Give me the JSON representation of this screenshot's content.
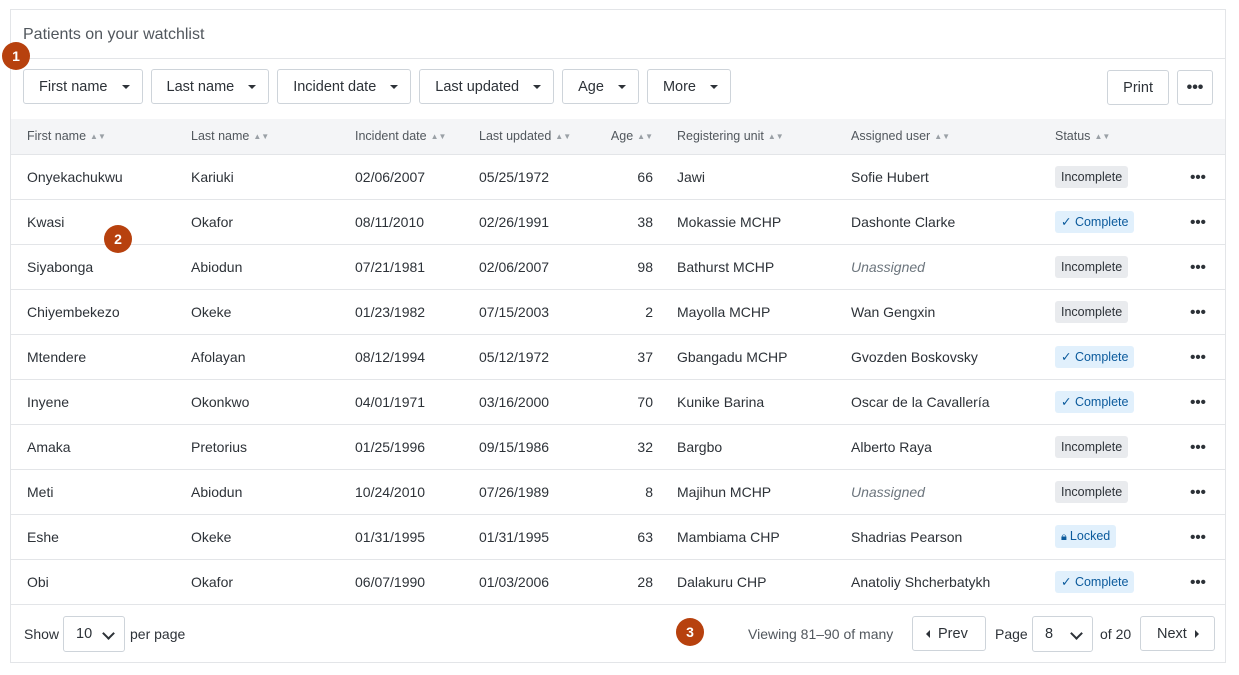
{
  "panel": {
    "title": "Patients on your watchlist"
  },
  "filters": [
    {
      "label": "First name"
    },
    {
      "label": "Last name"
    },
    {
      "label": "Incident date"
    },
    {
      "label": "Last updated"
    },
    {
      "label": "Age"
    },
    {
      "label": "More"
    }
  ],
  "toolbar": {
    "print_label": "Print",
    "more_icon": "ellipsis-icon"
  },
  "table": {
    "columns": [
      "First name",
      "Last name",
      "Incident date",
      "Last updated",
      "Age",
      "Registering unit",
      "Assigned user",
      "Status"
    ],
    "rows": [
      {
        "first": "Onyekachukwu",
        "last": "Kariuki",
        "incident": "02/06/2007",
        "updated": "05/25/1972",
        "age": "66",
        "unit": "Jawi",
        "user": "Sofie Hubert",
        "unassigned": false,
        "status": "Incomplete",
        "status_type": "incomplete"
      },
      {
        "first": "Kwasi",
        "last": "Okafor",
        "incident": "08/11/2010",
        "updated": "02/26/1991",
        "age": "38",
        "unit": "Mokassie MCHP",
        "user": "Dashonte Clarke",
        "unassigned": false,
        "status": "Complete",
        "status_type": "complete"
      },
      {
        "first": "Siyabonga",
        "last": "Abiodun",
        "incident": "07/21/1981",
        "updated": "02/06/2007",
        "age": "98",
        "unit": "Bathurst MCHP",
        "user": "Unassigned",
        "unassigned": true,
        "status": "Incomplete",
        "status_type": "incomplete"
      },
      {
        "first": "Chiyembekezo",
        "last": "Okeke",
        "incident": "01/23/1982",
        "updated": "07/15/2003",
        "age": "2",
        "unit": "Mayolla MCHP",
        "user": "Wan Gengxin",
        "unassigned": false,
        "status": "Incomplete",
        "status_type": "incomplete"
      },
      {
        "first": "Mtendere",
        "last": "Afolayan",
        "incident": "08/12/1994",
        "updated": "05/12/1972",
        "age": "37",
        "unit": "Gbangadu MCHP",
        "user": "Gvozden Boskovsky",
        "unassigned": false,
        "status": "Complete",
        "status_type": "complete"
      },
      {
        "first": "Inyene",
        "last": "Okonkwo",
        "incident": "04/01/1971",
        "updated": "03/16/2000",
        "age": "70",
        "unit": "Kunike Barina",
        "user": "Oscar de la Cavallería",
        "unassigned": false,
        "status": "Complete",
        "status_type": "complete"
      },
      {
        "first": "Amaka",
        "last": "Pretorius",
        "incident": "01/25/1996",
        "updated": "09/15/1986",
        "age": "32",
        "unit": "Bargbo",
        "user": "Alberto Raya",
        "unassigned": false,
        "status": "Incomplete",
        "status_type": "incomplete"
      },
      {
        "first": "Meti",
        "last": "Abiodun",
        "incident": "10/24/2010",
        "updated": "07/26/1989",
        "age": "8",
        "unit": "Majihun MCHP",
        "user": "Unassigned",
        "unassigned": true,
        "status": "Incomplete",
        "status_type": "incomplete"
      },
      {
        "first": "Eshe",
        "last": "Okeke",
        "incident": "01/31/1995",
        "updated": "01/31/1995",
        "age": "63",
        "unit": "Mambiama CHP",
        "user": "Shadrias Pearson",
        "unassigned": false,
        "status": "Locked",
        "status_type": "locked"
      },
      {
        "first": "Obi",
        "last": "Okafor",
        "incident": "06/07/1990",
        "updated": "01/03/2006",
        "age": "28",
        "unit": "Dalakuru CHP",
        "user": "Anatoliy Shcherbatykh",
        "unassigned": false,
        "status": "Complete",
        "status_type": "complete"
      }
    ]
  },
  "footer": {
    "show_label": "Show",
    "per_page_value": "10",
    "per_page_label": "per page",
    "viewing_text": "Viewing 81–90 of many",
    "prev_label": "Prev",
    "page_label": "Page",
    "page_value": "8",
    "of_label": "of 20",
    "next_label": "Next"
  },
  "markers": [
    "1",
    "2",
    "3"
  ],
  "colors": {
    "marker": "#b7410e",
    "complete_badge": "#e1f0fc",
    "incomplete_badge": "#e9ebee"
  }
}
